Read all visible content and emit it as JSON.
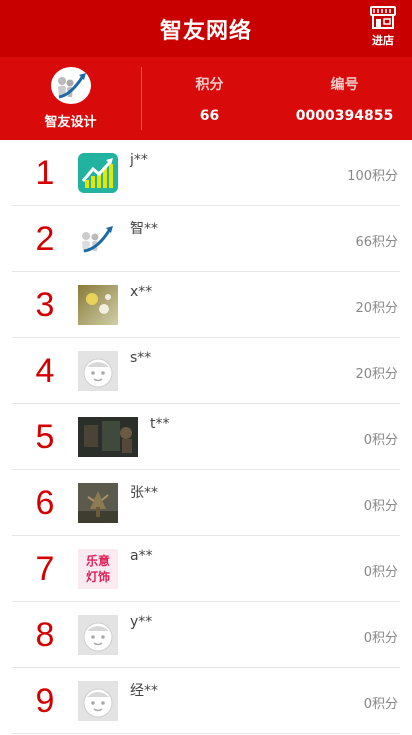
{
  "header": {
    "title": "智友网络",
    "shop_label": "进店"
  },
  "profile": {
    "name": "智友设计",
    "points_label": "积分",
    "points_value": "66",
    "id_label": "编号",
    "id_value": "0000394855"
  },
  "ranking": [
    {
      "rank": "1",
      "name": "j**",
      "points": "100积分",
      "avatar": "green-chart-icon"
    },
    {
      "rank": "2",
      "name": "智**",
      "points": "66积分",
      "avatar": "figures-arrow-image"
    },
    {
      "rank": "3",
      "name": "x**",
      "points": "20积分",
      "avatar": "flower-photo"
    },
    {
      "rank": "4",
      "name": "s**",
      "points": "20积分",
      "avatar": "default-avatar"
    },
    {
      "rank": "5",
      "name": "t**",
      "points": "0积分",
      "avatar": "dark-photo"
    },
    {
      "rank": "6",
      "name": "张**",
      "points": "0积分",
      "avatar": "tree-photo"
    },
    {
      "rank": "7",
      "name": "a**",
      "points": "0积分",
      "avatar": "shop-logo",
      "logo_text": "乐意灯饰"
    },
    {
      "rank": "8",
      "name": "y**",
      "points": "0积分",
      "avatar": "default-avatar"
    },
    {
      "rank": "9",
      "name": "经**",
      "points": "0积分",
      "avatar": "default-avatar"
    }
  ],
  "colors": {
    "header_bg": "#c80000",
    "profile_bg": "#d80a0a",
    "rank_red": "#d40000"
  }
}
